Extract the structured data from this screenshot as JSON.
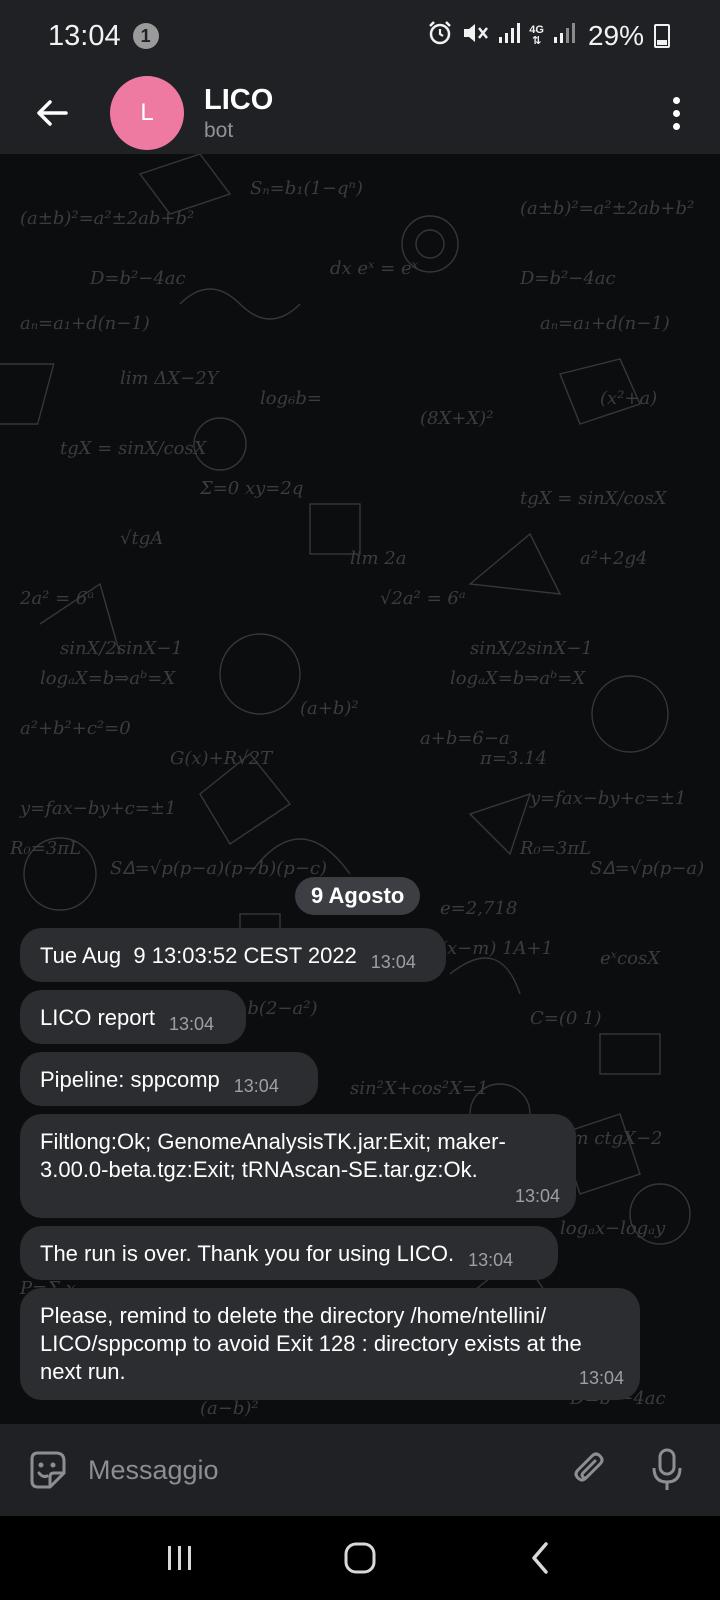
{
  "status_bar": {
    "time": "13:04",
    "notification_count": "1",
    "network": "4G",
    "battery": "29%"
  },
  "header": {
    "avatar_letter": "L",
    "title": "LICO",
    "subtitle": "bot",
    "avatar_color": "#ee7aa2"
  },
  "chat": {
    "date_separator": "9 Agosto",
    "messages": [
      {
        "text": "Tue Aug  9 13:03:52 CEST 2022",
        "time": "13:04"
      },
      {
        "text": "LICO report",
        "time": "13:04"
      },
      {
        "text": "Pipeline: sppcomp",
        "time": "13:04"
      },
      {
        "text": "Filtlong:Ok; GenomeAnalysisTK.jar:Exit; maker-3.00.0-beta.tgz:Exit; tRNAscan-SE.tar.gz:Ok.",
        "time": "13:04"
      },
      {
        "text": "The run is over. Thank you for using LICO.",
        "time": "13:04"
      },
      {
        "text": "Please, remind to delete the directory /home/ntellini/ LICO/sppcomp to avoid Exit 128 : directory exists at the next run.",
        "time": "13:04"
      }
    ]
  },
  "input": {
    "placeholder": "Messaggio"
  }
}
